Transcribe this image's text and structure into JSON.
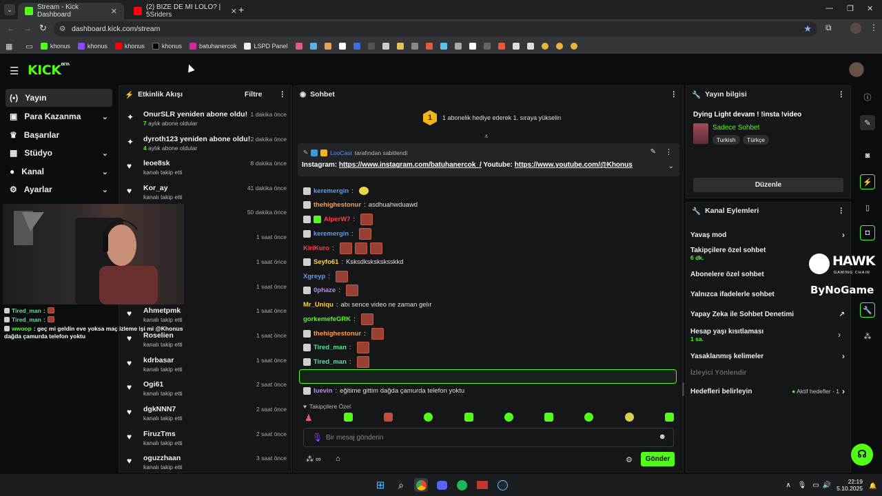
{
  "browser": {
    "tabs": [
      {
        "title": "Stream - Kick Dashboard"
      },
      {
        "title": "(2) BİZE DE Mİ LOLO? | 5Sriders"
      }
    ],
    "url": "dashboard.kick.com/stream",
    "bookmarks": [
      "khonus",
      "khonus",
      "khonus",
      "khonus",
      "batuhanercok",
      "LSPD Panel"
    ]
  },
  "kick": {
    "logo": "KICK",
    "logo_tag": "BETA"
  },
  "nav": [
    {
      "label": "Yayın",
      "icon": "dot-circle-icon"
    },
    {
      "label": "Para Kazanma",
      "icon": "wallet-icon"
    },
    {
      "label": "Başarılar",
      "icon": "trophy-icon"
    },
    {
      "label": "Stüdyo",
      "icon": "grid-icon"
    },
    {
      "label": "Kanal",
      "icon": "user-icon"
    },
    {
      "label": "Ayarlar",
      "icon": "gear-icon"
    }
  ],
  "activity": {
    "title": "Etkinlik Akışı",
    "filter": "Filtre",
    "events": [
      {
        "name": "OnurSLR yeniden abone oldu!",
        "detail_strong": "7",
        "detail": " aylık abone oldular",
        "time": "1 dakika önce"
      },
      {
        "name": "dyroth123 yeniden abone oldu!",
        "detail_strong": "4",
        "detail": " aylık abone oldular",
        "time": "2 dakika önce"
      },
      {
        "name": "leoe8sk",
        "detail": "kanalı takip etti",
        "time": "8 dakika önce"
      },
      {
        "name": "Kor_ay",
        "detail": "kanalı takip etti",
        "time": "41 dakika önce"
      },
      {
        "name": "",
        "detail": "",
        "time": "50 dakika önce"
      },
      {
        "name": "",
        "detail": "",
        "time": "1 saat önce"
      },
      {
        "name": "",
        "detail": "",
        "time": "1 saat önce"
      },
      {
        "name": "",
        "detail": "",
        "time": "1 saat önce"
      },
      {
        "name": "Ahmetpmk",
        "detail": "kanalı takip etti",
        "time": "1 saat önce"
      },
      {
        "name": "Roselien",
        "detail": "kanalı takip etti",
        "time": "1 saat önce"
      },
      {
        "name": "kdrbasar",
        "detail": "kanalı takip etti",
        "time": "1 saat önce"
      },
      {
        "name": "Ogi61",
        "detail": "kanalı takip etti",
        "time": "2 saat önce"
      },
      {
        "name": "dgkNNN7",
        "detail": "kanalı takip etti",
        "time": "2 saat önce"
      },
      {
        "name": "FiruzTms",
        "detail": "kanalı takip etti",
        "time": "2 saat önce"
      },
      {
        "name": "oguzzhaan",
        "detail": "kanalı takip etti",
        "time": "3 saat önce"
      }
    ]
  },
  "overlay_chat": [
    {
      "user": "Tired_man",
      "text": ":"
    },
    {
      "user": "Tired_man",
      "text": ":"
    },
    {
      "user": "wwoop",
      "text": ": geç mi geldin eve yoksa maç izleme işi mi @Khonus"
    },
    {
      "user": "",
      "text": "dağda çamurda telefon yoktu"
    }
  ],
  "chat": {
    "title": "Sohbet",
    "sub_gift": {
      "rank": "1",
      "text": "1 abonelik hediye ederek 1. sıraya yükselin"
    },
    "pinned": {
      "by_user": "LooCast",
      "by_text": "tarafından sabitlendi",
      "label1": "Instagram:",
      "link1": "https://www.instagram.com/batuhanercok_/",
      "label2": "Youtube:",
      "link2": "https://www.youtube.com/@Khonus"
    },
    "messages": [
      {
        "user": "keremergin",
        "color": "#5b9bff",
        "text": ""
      },
      {
        "user": "thehighestonur",
        "color": "#ff9e4a",
        "text": "asdhuahwduawd"
      },
      {
        "user": "AlperW7",
        "color": "#ff3c50",
        "text": ""
      },
      {
        "user": "keremergin",
        "color": "#5b9bff",
        "text": ""
      },
      {
        "user": "KiriKuro",
        "color": "#ff3c50",
        "text": ""
      },
      {
        "user": "Seyfo61",
        "color": "#ffd24a",
        "text": "Ksksdksksksksskkd"
      },
      {
        "user": "Xgreyp",
        "color": "#5b9bff",
        "text": ""
      },
      {
        "user": "0phaze",
        "color": "#b98aff",
        "text": ""
      },
      {
        "user": "Mr_Uniqu",
        "color": "#ffd24a",
        "text": "abı sence video ne zaman gelır"
      },
      {
        "user": "gorkemefeGRK",
        "color": "#53fc18",
        "text": ""
      },
      {
        "user": "thehighestonur",
        "color": "#ff9e4a",
        "text": ""
      },
      {
        "user": "Tired_man",
        "color": "#5be0a0",
        "text": ""
      },
      {
        "user": "Tired_man",
        "color": "#5be0a0",
        "text": ""
      },
      {
        "user": "wwoop",
        "color": "#53fc18",
        "text": "geç mi geldin eve yoksa maç izleme işi mi @Khonus"
      },
      {
        "user": "luevin",
        "color": "#b98aff",
        "text": "eğitime gittim dağda çamurda telefon yoktu"
      }
    ],
    "followers_only": "Takipçilere Özel",
    "input_placeholder": "Bir mesaj gönderin",
    "send": "Gönder"
  },
  "stream_info": {
    "title": "Yayın bilgisi",
    "stream_title": "Dying Light devam ! !insta !video",
    "category": "Sadece Sohbet",
    "tags": [
      "Turkish",
      "Türkçe"
    ],
    "edit": "Düzenle"
  },
  "channel_actions": {
    "title": "Kanal Eylemleri",
    "items": [
      {
        "label": "Yavaş mod",
        "sub": ""
      },
      {
        "label": "Takipçilere özel sohbet",
        "sub": "6 dk."
      },
      {
        "label": "Abonelere özel sohbet",
        "sub": ""
      },
      {
        "label": "Yalnızca ifadelerle sohbet",
        "sub": ""
      },
      {
        "label": "Yapay Zeka ile Sohbet Denetimi",
        "sub": ""
      },
      {
        "label": "Hesap yaşı kısıtlaması",
        "sub": "1 sa."
      },
      {
        "label": "Yasaklanmış kelimeler",
        "sub": ""
      },
      {
        "label": "İzleyici Yönlendir",
        "sub": ""
      },
      {
        "label": "Hedefleri belirleyin",
        "sub": "Aktif hedefler - 1"
      }
    ]
  },
  "overlay_brands": [
    "HAWK",
    "GAMING CHAIR",
    "ByNoGame"
  ],
  "taskbar": {
    "time": "22:19",
    "date": "5.10.2025"
  }
}
